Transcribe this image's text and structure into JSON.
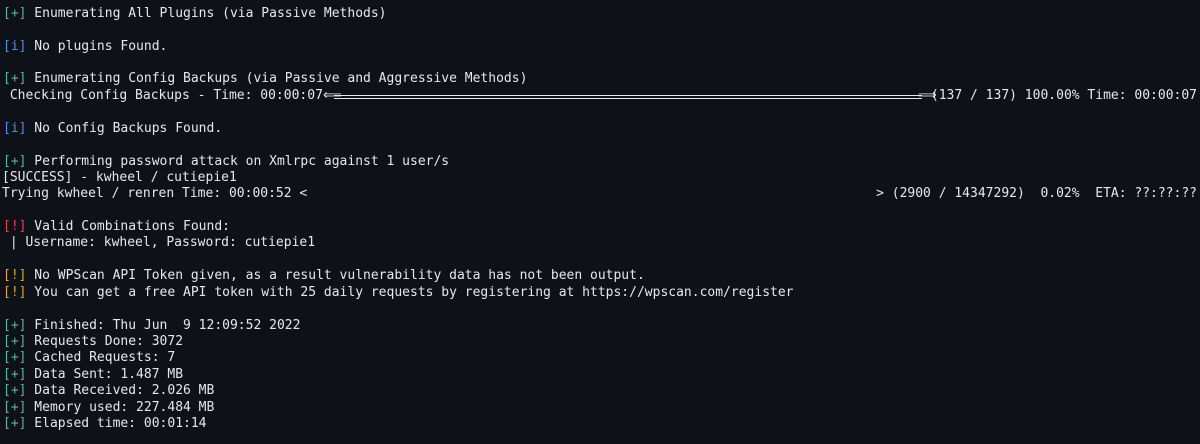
{
  "lines": {
    "l1_tag": "[+]",
    "l1_text": " Enumerating All Plugins (via Passive Methods)",
    "l2_tag": "[i]",
    "l2_text": " No plugins Found.",
    "l3_tag": "[+]",
    "l3_text": " Enumerating Config Backups (via Passive and Aggressive Methods)",
    "l4_left": " Checking Config Backups - Time: 00:00:07 ",
    "l4_right": " (137 / 137) 100.00% Time: 00:00:07",
    "l5_tag": "[i]",
    "l5_text": " No Config Backups Found.",
    "l6_tag": "[+]",
    "l6_text": " Performing password attack on Xmlrpc against 1 user/s",
    "l7_text": "[SUCCESS] - kwheel / cutiepie1",
    "l8_left": "Trying kwheel / renren Time: 00:00:52 <",
    "l8_right": "> (2900 / 14347292)  0.02%  ETA: ??:??:??",
    "l9_tag": "[!]",
    "l9_text": " Valid Combinations Found:",
    "l10_text": " | Username: kwheel, Password: cutiepie1",
    "l11_tag": "[!]",
    "l11_text": " No WPScan API Token given, as a result vulnerability data has not been output.",
    "l12_tag": "[!]",
    "l12_text": " You can get a free API token with 25 daily requests by registering at https://wpscan.com/register",
    "l13_tag": "[+]",
    "l13_text": " Finished: Thu Jun  9 12:09:52 2022",
    "l14_tag": "[+]",
    "l14_text": " Requests Done: 3072",
    "l15_tag": "[+]",
    "l15_text": " Cached Requests: 7",
    "l16_tag": "[+]",
    "l16_text": " Data Sent: 1.487 MB",
    "l17_tag": "[+]",
    "l17_text": " Data Received: 2.026 MB",
    "l18_tag": "[+]",
    "l18_text": " Memory used: 227.484 MB",
    "l19_tag": "[+]",
    "l19_text": " Elapsed time: 00:01:14"
  },
  "progress": {
    "config_backups_fraction": 1.0,
    "password_attack_fraction": 0.0002
  },
  "colors": {
    "background": "#0e1118",
    "text": "#e8e8e8",
    "plus_tag": "#56b6a3",
    "info_tag": "#4f8fe8",
    "critical_tag": "#e0484e",
    "warning_tag": "#e5a23b"
  }
}
